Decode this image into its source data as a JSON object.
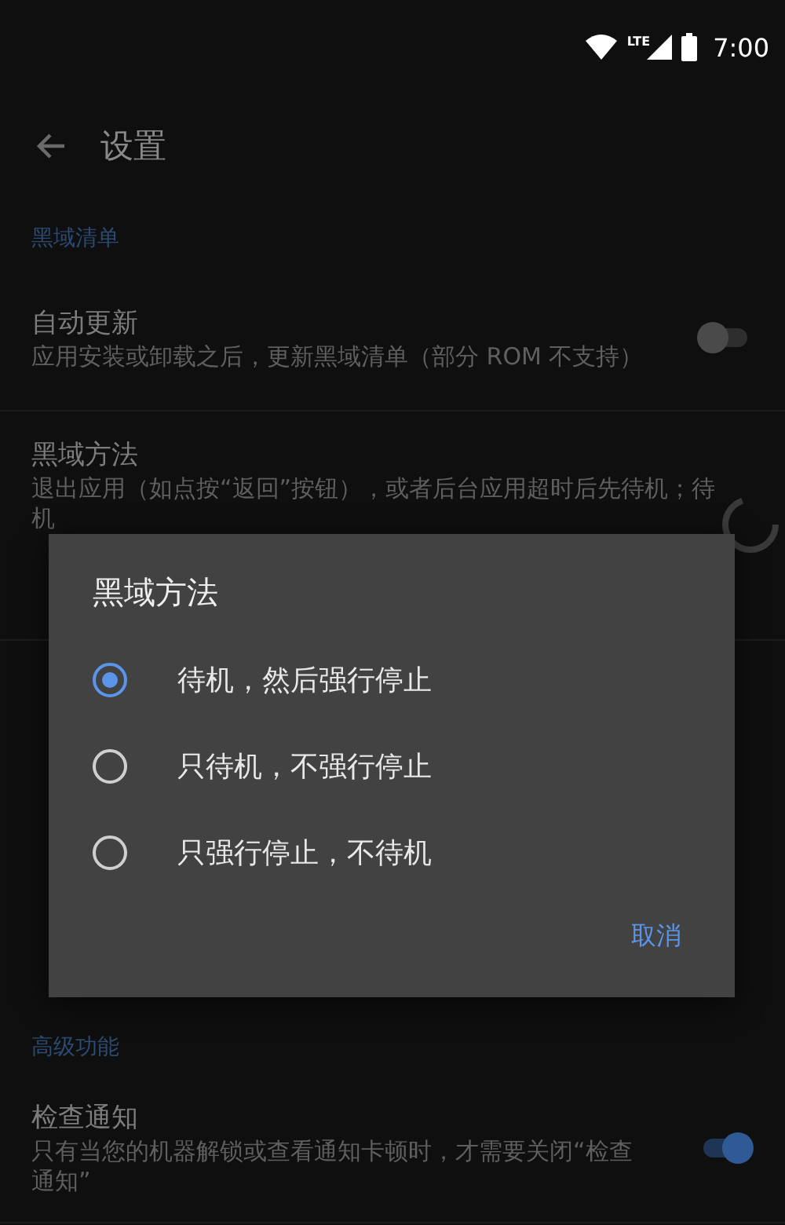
{
  "status_bar": {
    "network": "LTE",
    "time": "7:00"
  },
  "toolbar": {
    "title": "设置"
  },
  "sections": [
    {
      "header": "黑域清单",
      "items": [
        {
          "lines": [
            {
              "kind": "title",
              "text": "自动更新"
            },
            {
              "kind": "body",
              "text": "应用安装或卸载之后，更新黑域清单（部分 ROM 不支持）"
            }
          ],
          "control": {
            "kind": "switch",
            "on": false
          }
        },
        {
          "lines": [
            {
              "kind": "title",
              "text": "黑域方法"
            },
            {
              "kind": "body",
              "text": "退出应用（如点按“返回”按钮），或者后台应用超时后先待机；待机"
            }
          ],
          "control": {
            "kind": "spinner"
          }
        }
      ]
    },
    {
      "header": "高级功能",
      "items": [
        {
          "lines": [
            {
              "kind": "title",
              "text": "检查通知"
            },
            {
              "kind": "body",
              "text": "只有当您的机器解锁或查看通知卡顿时，才需要关闭“检查通知”"
            }
          ],
          "control": {
            "kind": "switch",
            "on": true
          }
        }
      ]
    }
  ],
  "dialog": {
    "title": "黑域方法",
    "options": [
      {
        "label": "待机，然后强行停止",
        "selected": true
      },
      {
        "label": "只待机，不强行停止",
        "selected": false
      },
      {
        "label": "只强行停止，不待机",
        "selected": false
      }
    ],
    "buttons": [
      "取消"
    ]
  }
}
